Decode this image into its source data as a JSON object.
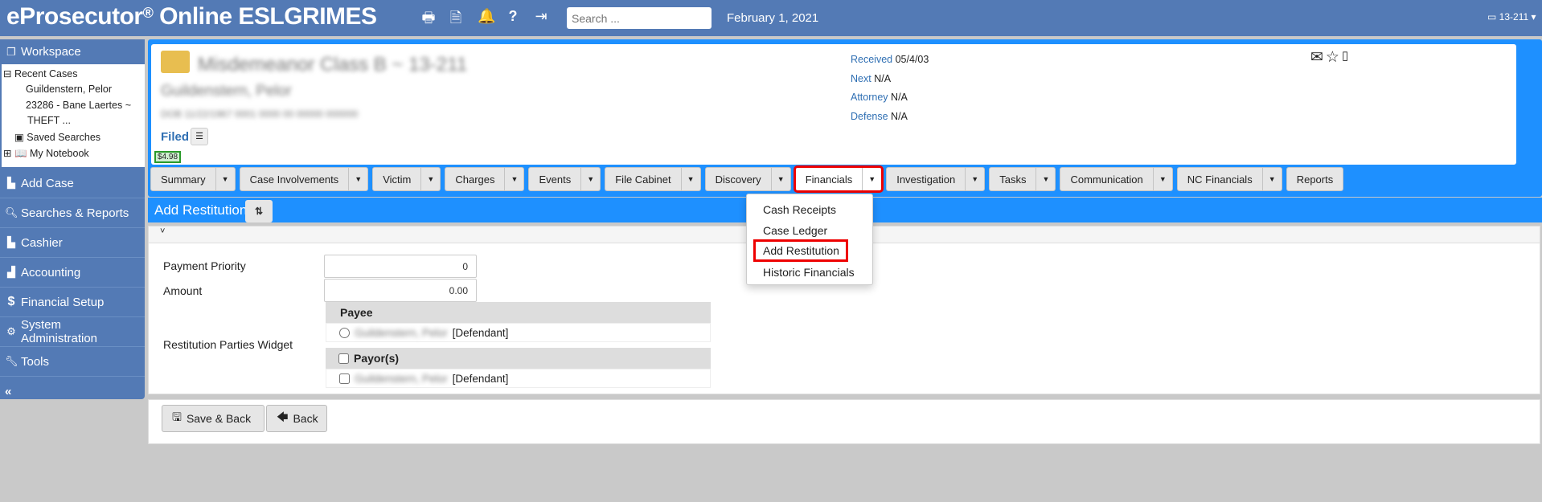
{
  "header": {
    "title": "eProsecutor",
    "reg": "®",
    "title_rest": " Online ESLGRIMES",
    "search_placeholder": "Search ...",
    "date": "February 1, 2021",
    "case_number": "13-211 ▾",
    "icons": [
      "print-icon",
      "document-icon",
      "bell-icon",
      "help-icon",
      "logout-icon"
    ],
    "color": "#537ab5"
  },
  "sidebar": {
    "workspace": "Workspace",
    "tree": {
      "recent": "Recent Cases",
      "case1": "Guildenstern, Pelor",
      "case2": "23286 - Bane Laertes ~",
      "case2b": "THEFT ...",
      "saved": "Saved Searches",
      "notebook": "My Notebook"
    },
    "items": [
      {
        "label": "Add Case"
      },
      {
        "label": "Searches & Reports"
      },
      {
        "label": "Cashier"
      },
      {
        "label": "Accounting"
      },
      {
        "label": "Financial Setup"
      },
      {
        "label": "System Administration"
      },
      {
        "label": "Tools"
      }
    ],
    "collapse": "«"
  },
  "case": {
    "status": "Filed",
    "balance": "$4.98",
    "fields": [
      {
        "label": "Received",
        "value": "05/4/03"
      },
      {
        "label": "Next",
        "value": "N/A"
      },
      {
        "label": "Attorney",
        "value": "N/A"
      },
      {
        "label": "Defense",
        "value": "N/A"
      }
    ]
  },
  "tabs": [
    {
      "label": "Summary",
      "caret": true
    },
    {
      "label": "Case Involvements",
      "caret": true
    },
    {
      "label": "Victim",
      "caret": true
    },
    {
      "label": "Charges",
      "caret": true
    },
    {
      "label": "Events",
      "caret": true
    },
    {
      "label": "File Cabinet",
      "caret": true
    },
    {
      "label": "Discovery",
      "caret": true
    },
    {
      "label": "Financials",
      "caret": true,
      "active": true
    },
    {
      "label": "Investigation",
      "caret": true
    },
    {
      "label": "Tasks",
      "caret": true
    },
    {
      "label": "Communication",
      "caret": true
    },
    {
      "label": "NC Financials",
      "caret": true
    },
    {
      "label": "Reports",
      "caret": false
    }
  ],
  "dropdown": [
    "Cash Receipts",
    "Case Ledger",
    "Add Restitution",
    "Historic Financials"
  ],
  "form": {
    "title": "Add Restitution",
    "collapse": "˅",
    "payment_priority_label": "Payment Priority",
    "payment_priority": "0",
    "amount_label": "Amount",
    "amount": "0.00",
    "widget_label": "Restitution Parties Widget",
    "payee_header": "Payee",
    "payee_role": "[Defendant]",
    "payor_header": "Payor(s)",
    "payor_role": "[Defendant]"
  },
  "buttons": {
    "save_back": "Save & Back",
    "back": "Back"
  }
}
